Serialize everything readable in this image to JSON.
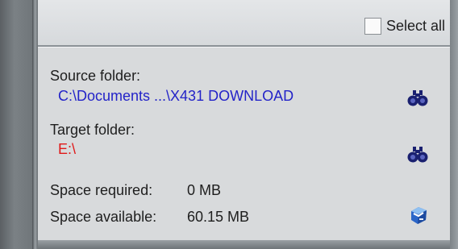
{
  "top": {
    "select_all_label": "Select all",
    "select_all_checked": false
  },
  "info": {
    "source_label": "Source folder:",
    "source_path": "C:\\Documents ...\\X431 DOWNLOAD",
    "target_label": "Target folder:",
    "target_path": "E:\\",
    "space_required_label": "Space required:",
    "space_required_value": "0 MB",
    "space_available_label": "Space available:",
    "space_available_value": "60.15 MB"
  },
  "icons": {
    "source_browse": "binoculars-icon",
    "target_browse": "binoculars-icon",
    "drive": "drive-icon"
  },
  "colors": {
    "source_path": "#2323c8",
    "target_path": "#e01818",
    "text": "#1e1e1e",
    "panel_bg": "#d8dadc"
  }
}
